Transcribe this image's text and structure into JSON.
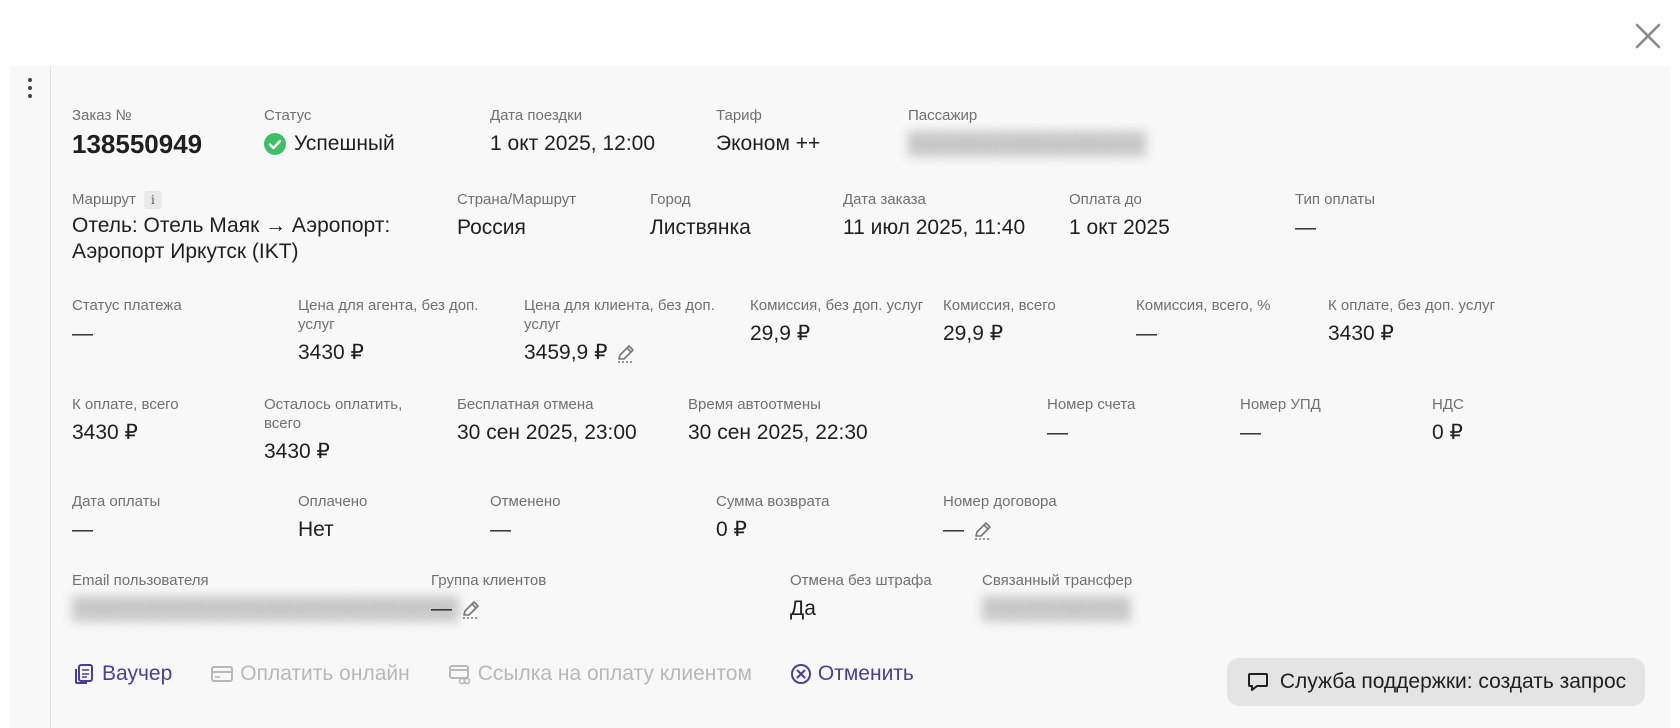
{
  "order": {
    "number_label": "Заказ №",
    "number": "138550949",
    "status_label": "Статус",
    "status": "Успешный",
    "trip_date_label": "Дата поездки",
    "trip_date": "1 окт 2025, 12:00",
    "tariff_label": "Тариф",
    "tariff": "Эконом ++",
    "passenger_label": "Пассажир",
    "route_label": "Маршрут",
    "route_line1": "Отель: Отель Маяк → Аэропорт:",
    "route_line2": "Аэропорт Иркутск (IKT)",
    "country_label": "Страна/Маршрут",
    "country": "Россия",
    "city_label": "Город",
    "city": "Листвянка",
    "order_date_label": "Дата заказа",
    "order_date": "11 июл 2025, 11:40",
    "pay_until_label": "Оплата до",
    "pay_until": "1 окт 2025",
    "pay_type_label": "Тип оплаты",
    "pay_type": "—",
    "payment_status_label": "Статус платежа",
    "payment_status": "—",
    "agent_price_label_1": "Цена для агента, без доп.",
    "agent_price_label_2": "услуг",
    "agent_price": "3430 ₽",
    "client_price_label_1": "Цена для клиента, без доп.",
    "client_price_label_2": "услуг",
    "client_price": "3459,9 ₽",
    "commission_label": "Комиссия, без доп. услуг",
    "commission": "29,9 ₽",
    "commission_total_label": "Комиссия, всего",
    "commission_total": "29,9 ₽",
    "commission_pct_label": "Комиссия, всего, %",
    "commission_pct": "—",
    "to_pay_no_extra_label": "К оплате, без доп. услуг",
    "to_pay_no_extra": "3430 ₽",
    "to_pay_total_label": "К оплате, всего",
    "to_pay_total": "3430 ₽",
    "remaining_label_1": "Осталось оплатить,",
    "remaining_label_2": "всего",
    "remaining": "3430 ₽",
    "free_cancel_label": "Бесплатная отмена",
    "free_cancel": "30 сен 2025, 23:00",
    "auto_cancel_label": "Время автоотмены",
    "auto_cancel": "30 сен 2025, 22:30",
    "invoice_label": "Номер счета",
    "invoice": "—",
    "upd_label": "Номер УПД",
    "upd": "—",
    "vat_label": "НДС",
    "vat": "0 ₽",
    "paid_date_label": "Дата оплаты",
    "paid_date": "—",
    "paid_label": "Оплачено",
    "paid": "Нет",
    "cancelled_label": "Отменено",
    "cancelled": "—",
    "refund_label": "Сумма возврата",
    "refund": "0 ₽",
    "contract_label": "Номер договора",
    "contract": "—",
    "email_label": "Email пользователя",
    "client_group_label": "Группа клиентов",
    "client_group": "—",
    "no_penalty_label": "Отмена без штрафа",
    "no_penalty": "Да",
    "linked_transfer_label": "Связанный трансфер"
  },
  "actions": {
    "voucher": "Ваучер",
    "pay_online": "Оплатить онлайн",
    "payment_link": "Ссылка на оплату клиентом",
    "cancel": "Отменить",
    "support": "Служба поддержки: создать запрос"
  },
  "colors": {
    "accent": "#4b3f91",
    "success": "#3fbe6a",
    "disabled": "#b8b8b8"
  }
}
